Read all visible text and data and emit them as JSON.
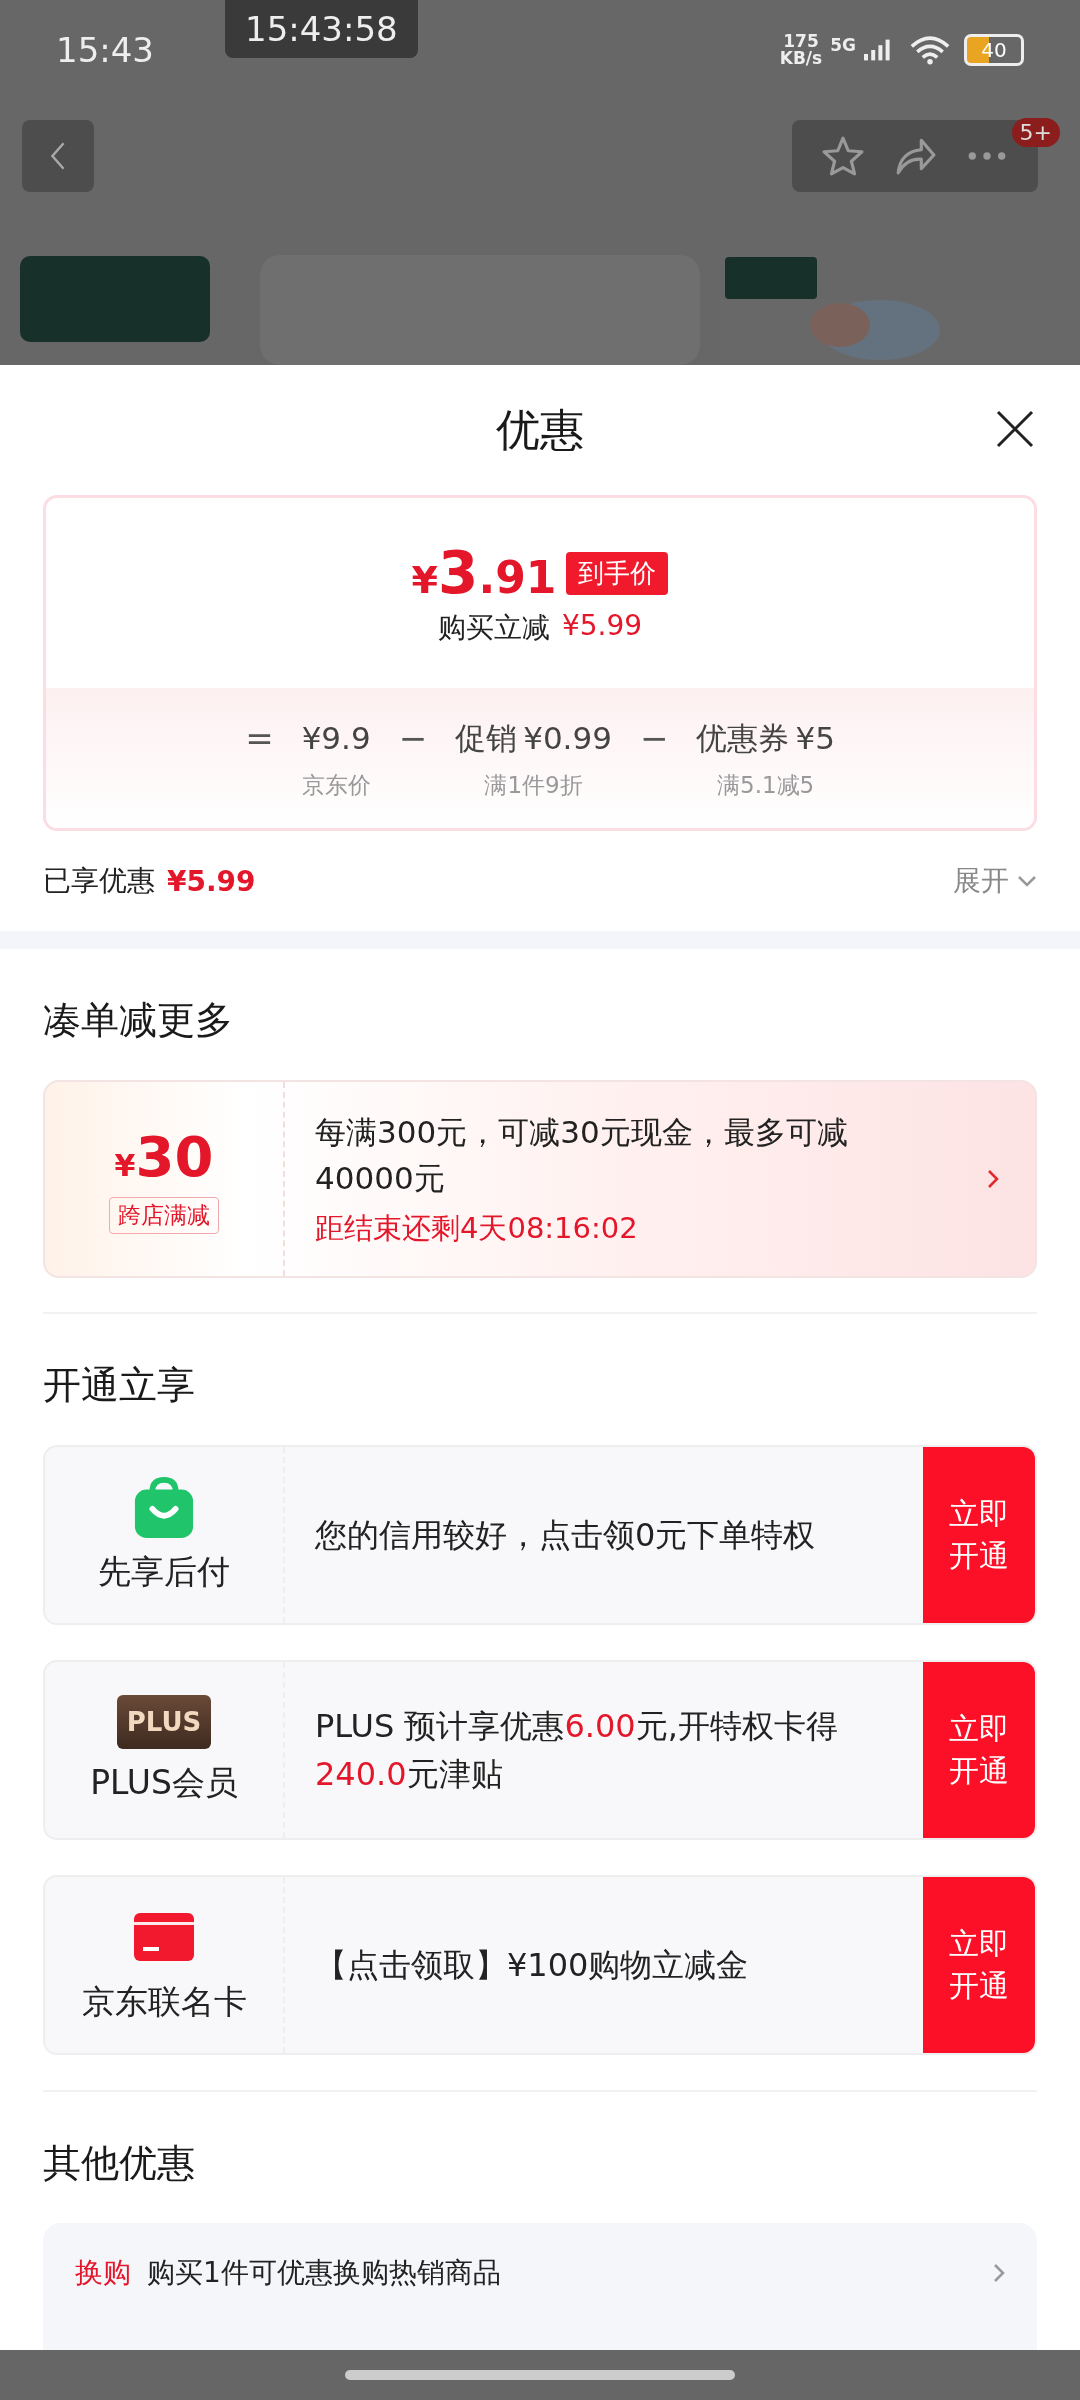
{
  "status_bar": {
    "time": "15:43",
    "overlay_clock": "15:43:58",
    "speed_value": "175",
    "speed_unit": "KB/s",
    "network": "5G",
    "battery": "40"
  },
  "top_bar": {
    "badge": "5+"
  },
  "sheet": {
    "title": "优惠",
    "price_card": {
      "currency": "¥",
      "price_int": "3",
      "price_dec": ".91",
      "price_tag": "到手价",
      "cut_label": "购买立减",
      "cut_amount": "¥5.99",
      "breakdown": [
        {
          "op": "=",
          "amount": "¥9.9",
          "note": "京东价"
        },
        {
          "op": "−",
          "name": "促销",
          "amount": "¥0.99",
          "note": "满1件9折"
        },
        {
          "op": "−",
          "name": "优惠券",
          "amount": "¥5",
          "note": "满5.1减5"
        }
      ]
    },
    "saved": {
      "label": "已享优惠",
      "amount": "¥5.99",
      "expand": "展开"
    },
    "bundle": {
      "title": "凑单减更多",
      "currency": "¥",
      "amount": "30",
      "tag": "跨店满减",
      "text": "每满300元，可减30元现金，最多可减40000元",
      "countdown": "距结束还剩4天08:16:02"
    },
    "open": {
      "title": "开通立享",
      "items": [
        {
          "kind": "bag",
          "name": "先享后付",
          "text": [
            {
              "t": "您的信用较好，点击领0元下单特权",
              "red": false
            }
          ],
          "button": "立即开通"
        },
        {
          "kind": "plus",
          "icon_text": "PLUS",
          "name": "PLUS会员",
          "text": [
            {
              "t": "PLUS 预计享优惠",
              "red": false
            },
            {
              "t": "6.00",
              "red": true
            },
            {
              "t": "元,开特权卡得",
              "red": false
            },
            {
              "t": "240.0",
              "red": true
            },
            {
              "t": "元津贴",
              "red": false
            }
          ],
          "button": "立即开通"
        },
        {
          "kind": "card",
          "name": "京东联名卡",
          "text": [
            {
              "t": "【点击领取】¥100购物立减金",
              "red": false
            }
          ],
          "button": "立即开通"
        }
      ]
    },
    "other": {
      "title": "其他优惠",
      "items": [
        {
          "tag": "换购",
          "text": "购买1件可优惠换购热销商品"
        }
      ]
    }
  }
}
